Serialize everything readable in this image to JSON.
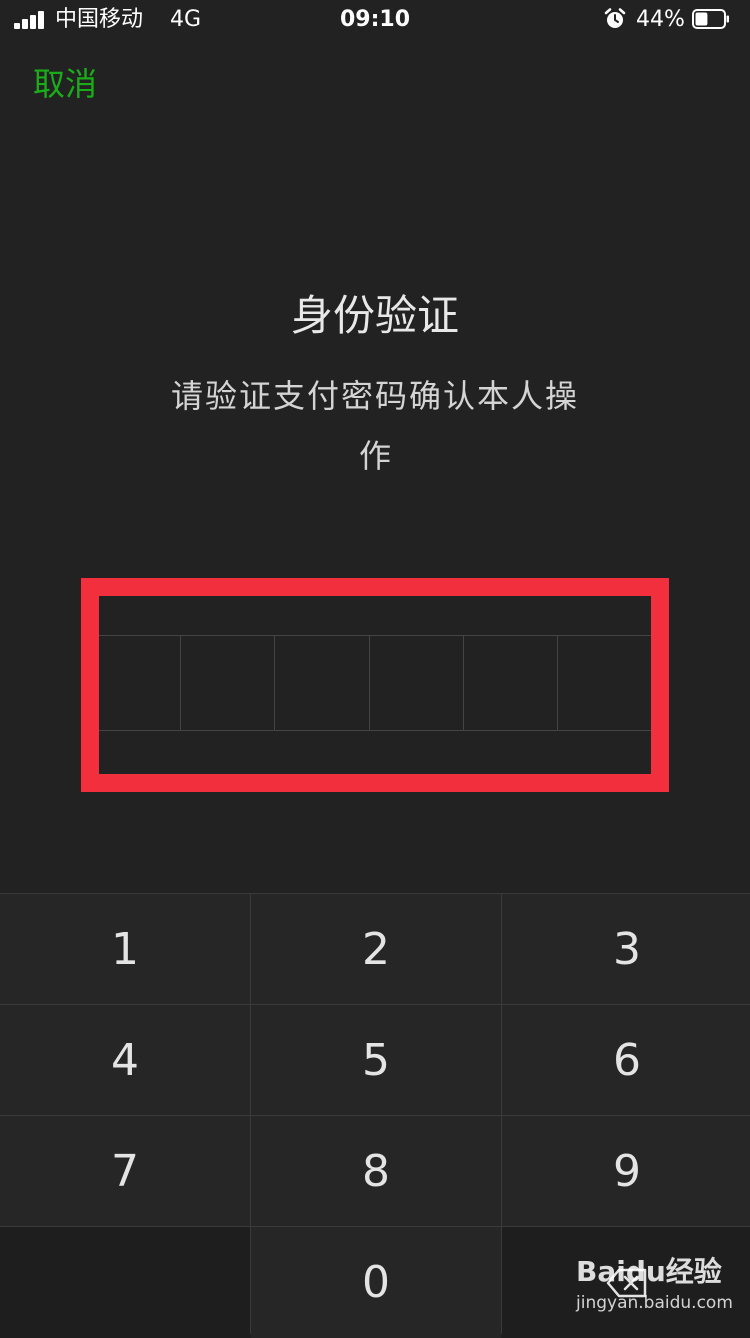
{
  "status_bar": {
    "carrier": "中国移动",
    "network": "4G",
    "time": "09:10",
    "battery_percent": "44%",
    "battery_level": 0.44,
    "signal_bars": 4,
    "icons": [
      "signal-icon",
      "alarm-icon",
      "battery-icon"
    ]
  },
  "header": {
    "cancel_label": "取消"
  },
  "verification": {
    "title": "身份验证",
    "subtitle_line1": "请验证支付密码确认本人操",
    "subtitle_line2": "作",
    "digits_count": 6,
    "entered_digits": 0
  },
  "keypad": {
    "keys": [
      "1",
      "2",
      "3",
      "4",
      "5",
      "6",
      "7",
      "8",
      "9",
      "",
      "0",
      "delete"
    ],
    "delete_icon": "backspace-icon"
  },
  "watermark": {
    "brand": "Baidu经验",
    "url": "jingyan.baidu.com"
  },
  "colors": {
    "background": "#222222",
    "accent": "#1aad19",
    "highlight": "#f22f3c",
    "text": "#e6e6e6"
  }
}
